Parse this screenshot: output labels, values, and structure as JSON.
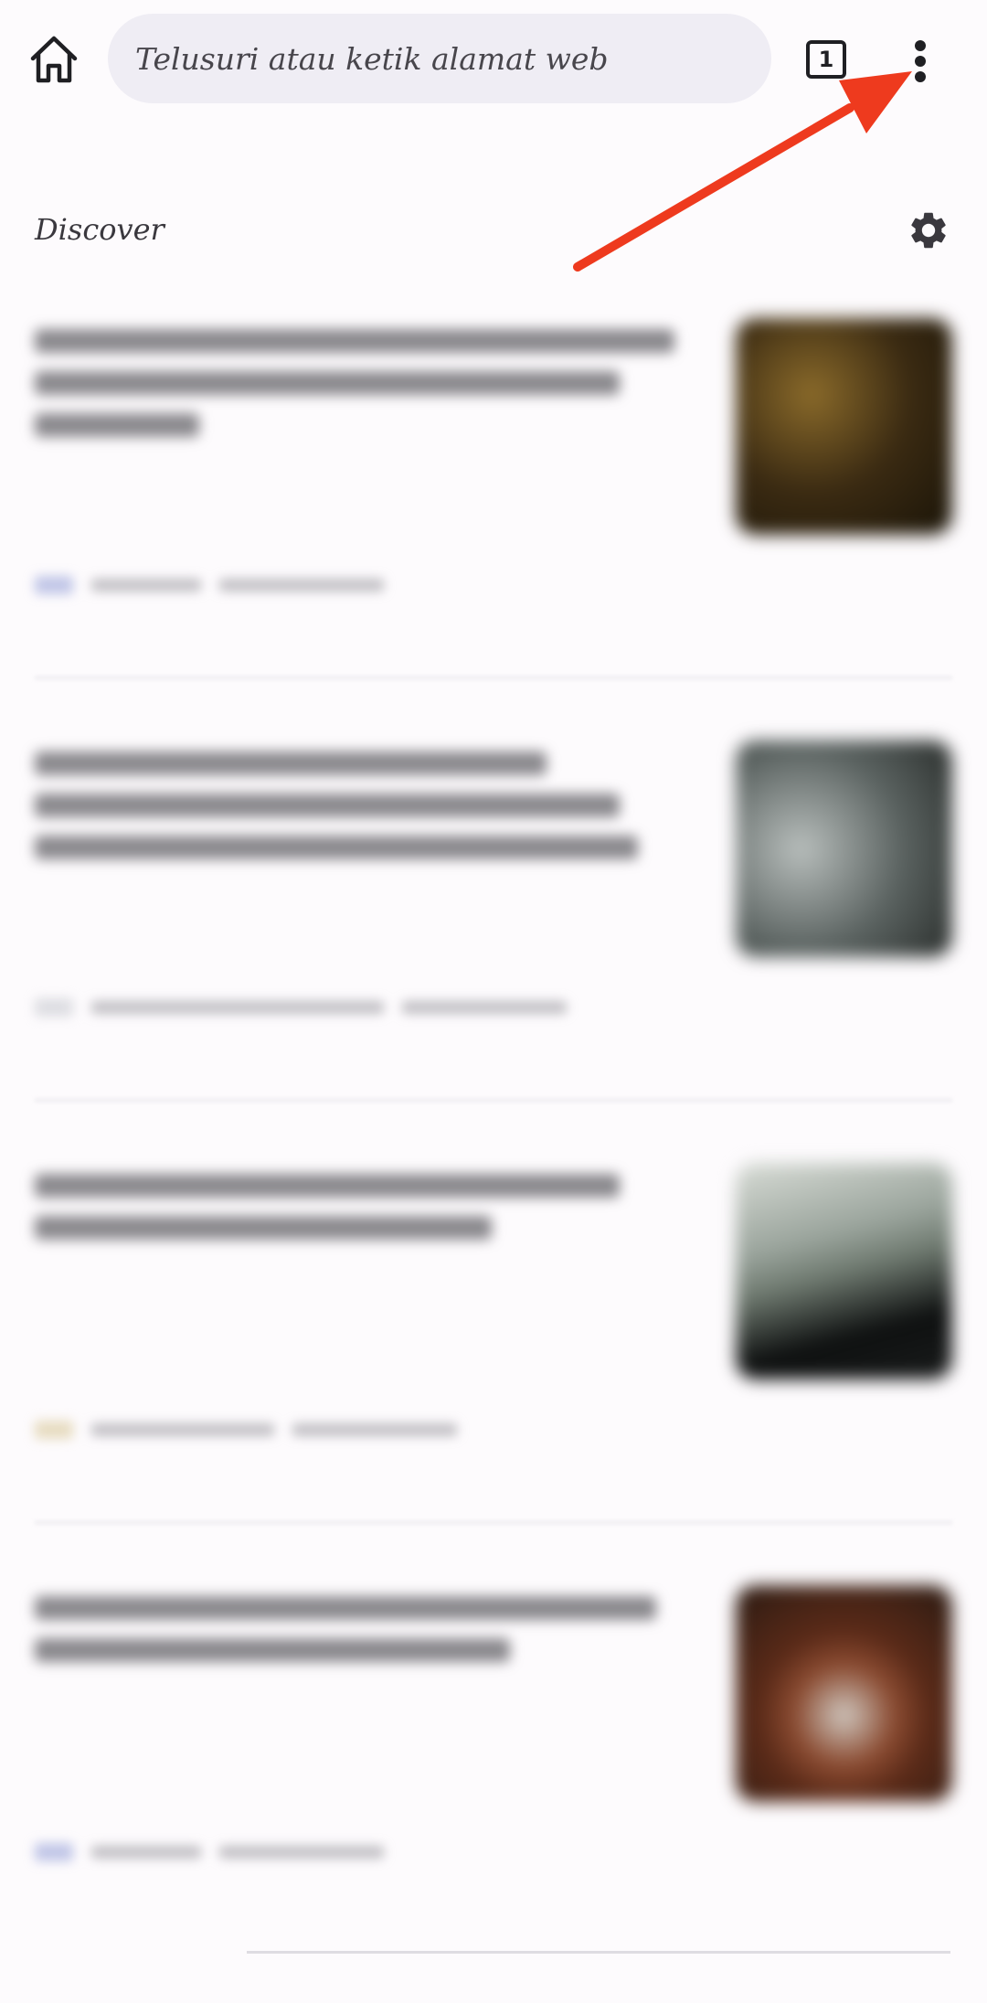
{
  "toolbar": {
    "search_placeholder": "Telusuri atau ketik alamat web",
    "tab_count": "1",
    "home_icon": "home-icon",
    "menu_icon": "more-vert-icon"
  },
  "discover": {
    "label": "Discover",
    "settings_icon": "gear-icon"
  },
  "feed": {
    "cards": [
      {
        "thumb_colors": [
          "#3a2a12",
          "#8a6a2a",
          "#1a1408"
        ]
      },
      {
        "thumb_colors": [
          "#5a6260",
          "#b8bebc",
          "#2a2e2c"
        ]
      },
      {
        "thumb_colors": [
          "#d8dcd6",
          "#6f7a70",
          "#0e1010"
        ]
      },
      {
        "thumb_colors": [
          "#2a1a12",
          "#d0c8c0",
          "#5a2a18"
        ]
      }
    ]
  },
  "annotation": {
    "arrow_color": "#ee3a1e"
  }
}
